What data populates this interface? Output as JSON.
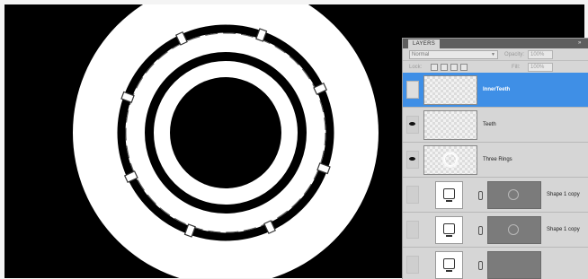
{
  "panel": {
    "tab_label": "LAYERS",
    "collapse_glyph": "»",
    "blend_mode": "Normal",
    "opacity_label": "Opacity:",
    "opacity_value": "100%",
    "lock_label": "Lock:",
    "fill_label": "Fill:",
    "fill_value": "100%"
  },
  "layers": [
    {
      "name": "InnerTeeth",
      "selected": true,
      "visible": false,
      "type": "raster"
    },
    {
      "name": "Teeth",
      "selected": false,
      "visible": true,
      "type": "raster"
    },
    {
      "name": "Three Rings",
      "selected": false,
      "visible": true,
      "type": "raster"
    },
    {
      "name": "Shape 1 copy",
      "selected": false,
      "visible": false,
      "type": "shape"
    },
    {
      "name": "Shape 1 copy",
      "selected": false,
      "visible": false,
      "type": "shape"
    },
    {
      "name": "",
      "selected": false,
      "visible": false,
      "type": "shape"
    }
  ],
  "colors": {
    "selection": "#3f8fe6",
    "canvas_background": "#000000",
    "artwork": "#ffffff"
  },
  "icons": {
    "eye": "eye-icon",
    "shape": "vector-shape-icon",
    "chain": "chain-link-icon",
    "locks": [
      "lock-transparency-icon",
      "lock-pixels-icon",
      "lock-position-icon",
      "lock-all-icon"
    ]
  }
}
